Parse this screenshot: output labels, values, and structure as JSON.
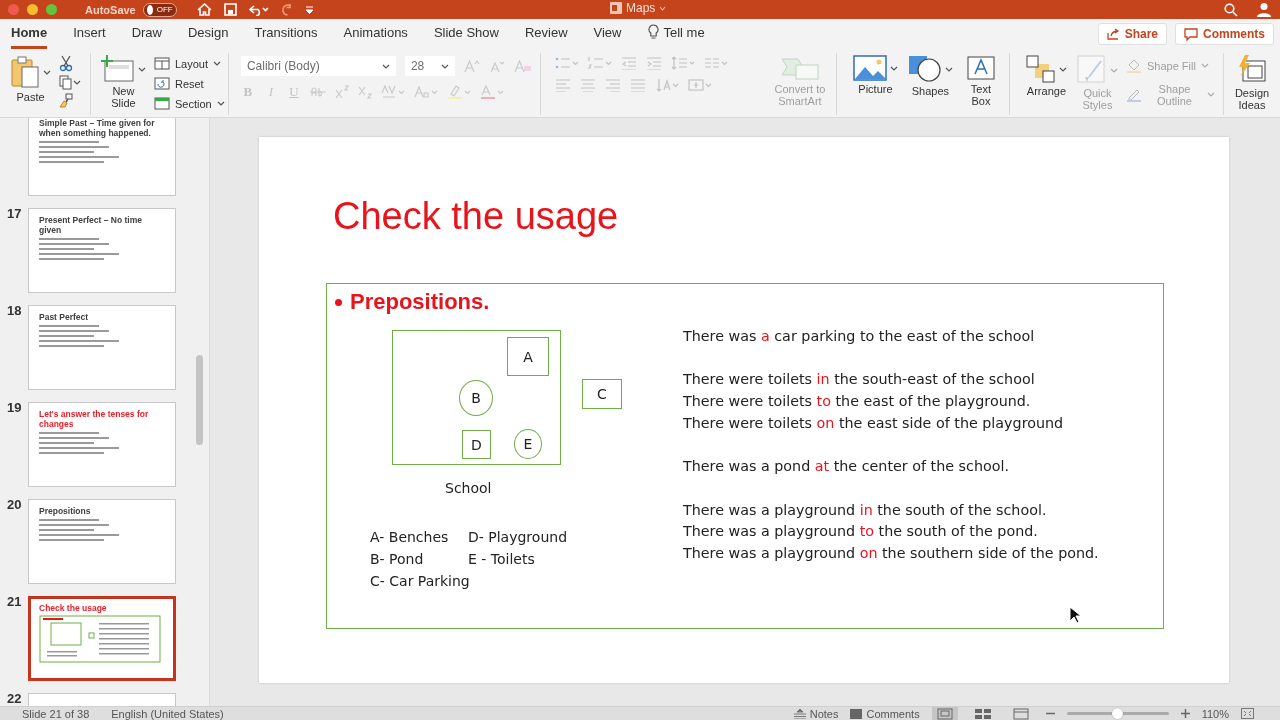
{
  "window": {
    "title": "Maps",
    "autosave": {
      "label": "AutoSave",
      "toggle": {
        "label": "OFF",
        "on": false
      }
    }
  },
  "tabs": [
    {
      "label": "Home",
      "selected": true
    },
    {
      "label": "Insert",
      "selected": false
    },
    {
      "label": "Draw",
      "selected": false
    },
    {
      "label": "Design",
      "selected": false
    },
    {
      "label": "Transitions",
      "selected": false
    },
    {
      "label": "Animations",
      "selected": false
    },
    {
      "label": "Slide Show",
      "selected": false
    },
    {
      "label": "Review",
      "selected": false
    },
    {
      "label": "View",
      "selected": false
    }
  ],
  "tell_me": "Tell me",
  "share": "Share",
  "comments": "Comments",
  "ribbon": {
    "paste": "Paste",
    "new_slide": "New Slide",
    "layout": "Layout",
    "reset": "Reset",
    "section": "Section",
    "font": {
      "value": "Calibri (Body)",
      "size": "28",
      "disabled": true
    },
    "bold": "B",
    "italic": "I",
    "underline": "U",
    "convert_smartart": {
      "label": "Convert to SmartArt",
      "disabled": true
    },
    "picture": "Picture",
    "shapes": "Shapes",
    "text_box": "Text Box",
    "arrange": "Arrange",
    "quick_styles": {
      "label": "Quick Styles",
      "disabled": true
    },
    "shape_fill": {
      "label": "Shape Fill",
      "disabled": true
    },
    "shape_outline": {
      "label": "Shape Outline",
      "disabled": true
    },
    "design_ideas": "Design Ideas"
  },
  "thumbnails": [
    {
      "title": "Simple Past – Time given for when something happened.",
      "color": "#404040",
      "kind": "bullets",
      "selected": false
    },
    {
      "number": "17",
      "title": "Present Perfect – No time given",
      "color": "#404040",
      "kind": "bullets",
      "selected": false
    },
    {
      "number": "18",
      "title": "Past Perfect",
      "color": "#404040",
      "kind": "bullets",
      "selected": false
    },
    {
      "number": "19",
      "title": "Let's answer the tenses for changes",
      "color": "#e8202a",
      "kind": "bullets",
      "selected": false
    },
    {
      "number": "20",
      "title": "Prepositions",
      "color": "#404040",
      "kind": "bullets",
      "selected": false
    },
    {
      "number": "21",
      "title": "Check the usage",
      "color": "#e8202a",
      "kind": "diagram",
      "selected": true
    },
    {
      "number": "22",
      "selected": false
    }
  ],
  "slide": {
    "title": "Check the usage",
    "heading": "Prepositions.",
    "diagram": {
      "label": "School",
      "nodes": [
        {
          "label": "A",
          "kind": "box"
        },
        {
          "label": "B",
          "kind": "circle"
        },
        {
          "label": "C",
          "kind": "box"
        },
        {
          "label": "D",
          "kind": "box"
        },
        {
          "label": "E",
          "kind": "circle"
        }
      ]
    },
    "legend": [
      "A- Benches",
      "D- Playground",
      "B- Pond",
      "E - Toilets",
      "C- Car Parking"
    ],
    "sentence_groups": [
      [
        [
          {
            "text": "There was ",
            "highlighted": false
          },
          {
            "text": "a",
            "highlighted": true
          },
          {
            "text": " car parking to the east of the school",
            "highlighted": false
          }
        ]
      ],
      [
        [
          {
            "text": "There were toilets ",
            "highlighted": false
          },
          {
            "text": "in",
            "highlighted": true
          },
          {
            "text": " the south-east of the school",
            "highlighted": false
          }
        ],
        [
          {
            "text": "There were toilets ",
            "highlighted": false
          },
          {
            "text": "to",
            "highlighted": true
          },
          {
            "text": " the east of the playground.",
            "highlighted": false
          }
        ],
        [
          {
            "text": "There were toilets ",
            "highlighted": false
          },
          {
            "text": "on",
            "highlighted": true
          },
          {
            "text": " the east side of the playground",
            "highlighted": false
          }
        ]
      ],
      [
        [
          {
            "text": "There was a pond ",
            "highlighted": false
          },
          {
            "text": "at",
            "highlighted": true
          },
          {
            "text": " the center of the school.",
            "highlighted": false
          }
        ]
      ],
      [
        [
          {
            "text": "There was a playground ",
            "highlighted": false
          },
          {
            "text": "in",
            "highlighted": true
          },
          {
            "text": " the south of the school.",
            "highlighted": false
          }
        ],
        [
          {
            "text": "There was a playground ",
            "highlighted": false
          },
          {
            "text": "to",
            "highlighted": true
          },
          {
            "text": " the south of the pond.",
            "highlighted": false
          }
        ],
        [
          {
            "text": "There was a playground ",
            "highlighted": false
          },
          {
            "text": "on",
            "highlighted": true
          },
          {
            "text": " the southern side of the pond.",
            "highlighted": false
          }
        ]
      ]
    ]
  },
  "status_bar": {
    "slide": "Slide 21 of 38",
    "language": "English (United States)",
    "notes": "Notes",
    "comments": "Comments",
    "views": [
      {
        "selected": true
      },
      {
        "selected": false
      },
      {
        "selected": false
      }
    ],
    "zoom": {
      "level": 0.49,
      "reading": "110%"
    }
  }
}
